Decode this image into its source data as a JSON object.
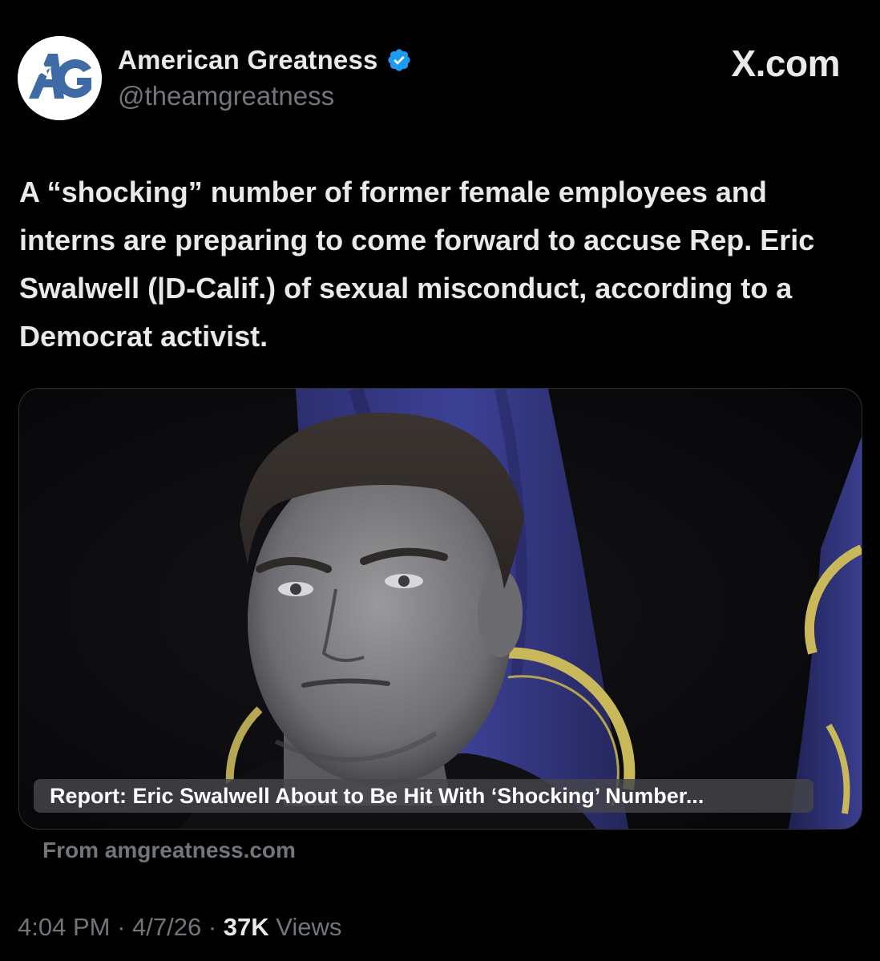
{
  "author": {
    "display_name": "American Greatness",
    "handle": "@theamgreatness",
    "avatar_text": "AG",
    "verified": true
  },
  "site_label": "X.com",
  "post": {
    "text": "A “shocking” number of former female employees and interns are preparing to come forward to accuse Rep. Eric Swalwell (|D-Calif.) of sexual misconduct, according to a Democrat activist."
  },
  "card": {
    "title": "Report: Eric Swalwell About to Be Hit With ‘Shocking’ Number...",
    "source": "From amgreatness.com"
  },
  "meta": {
    "time": "4:04 PM",
    "separator": " · ",
    "date": "4/7/26",
    "views_count": "37K",
    "views_label": " Views"
  },
  "colors": {
    "background": "#000000",
    "text_primary": "#e7e9ea",
    "text_secondary": "#71767b",
    "verified_blue": "#1d9bf0",
    "avatar_blue": "#3e6aa6"
  }
}
